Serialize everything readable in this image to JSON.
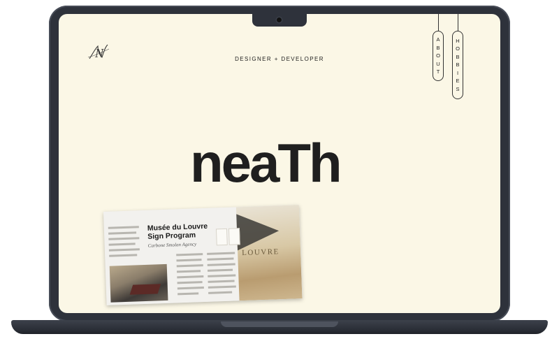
{
  "site": {
    "tagline": "DESIGNER + DEVELOPER",
    "logo_monogram": "N",
    "hero_wordmark": "neaTh"
  },
  "nav": {
    "items": [
      {
        "label": "ABOUT",
        "letters": [
          "A",
          "B",
          "O",
          "U",
          "T"
        ]
      },
      {
        "label": "HOBBIES",
        "letters": [
          "H",
          "O",
          "B",
          "B",
          "I",
          "E",
          "S"
        ]
      }
    ]
  },
  "project_card": {
    "title_line1": "Musée du Louvre",
    "title_line2": "Sign Program",
    "subtitle": "Carbone Smolan Agency",
    "image_sign_text": "LOUVRE"
  },
  "colors": {
    "screen_bg": "#fbf7e6",
    "text": "#1f1f1f",
    "device_frame": "#2e323b"
  }
}
